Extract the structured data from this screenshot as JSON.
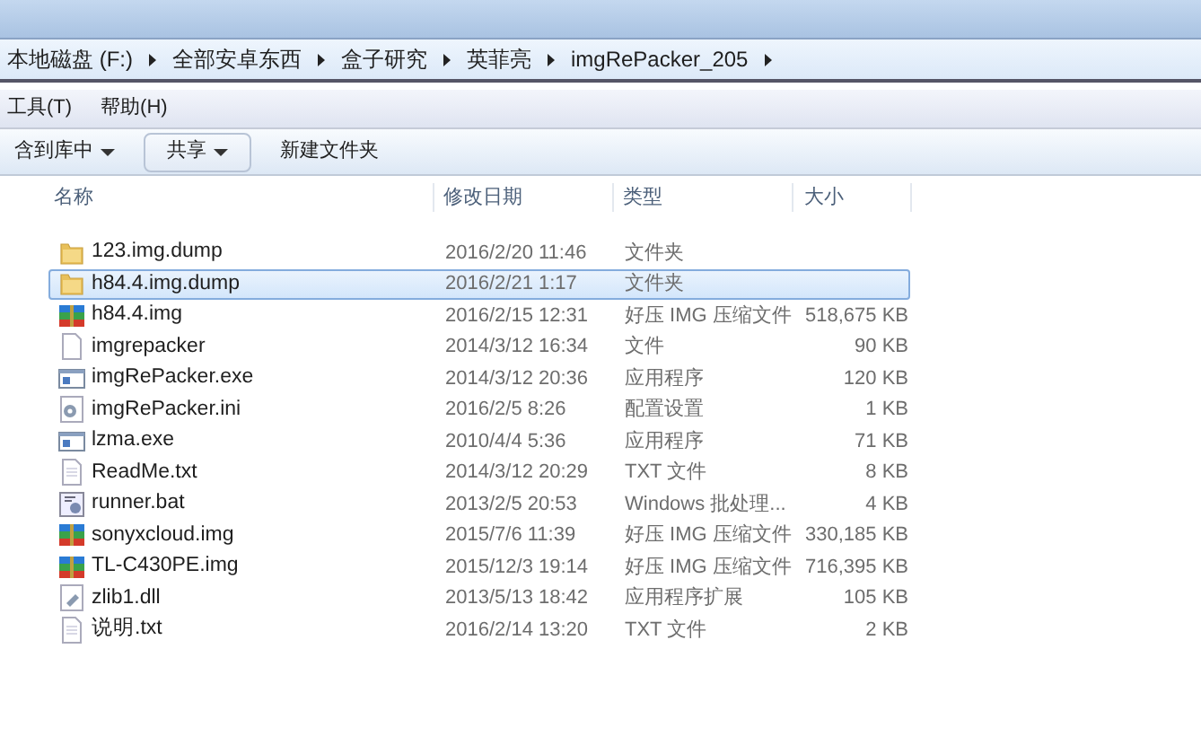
{
  "address_bar": {
    "crumbs": [
      "本地磁盘 (F:)",
      "全部安卓东西",
      "盒子研究",
      "英菲亮",
      "imgRePacker_205"
    ]
  },
  "menu_bar": {
    "items": [
      "工具(T)",
      "帮助(H)"
    ]
  },
  "toolbar": {
    "items": [
      {
        "label": "含到库中",
        "dropdown": true,
        "kind": "menu"
      },
      {
        "label": "共享",
        "dropdown": true,
        "kind": "button"
      },
      {
        "label": "新建文件夹",
        "dropdown": false,
        "kind": "menu"
      }
    ]
  },
  "table": {
    "columns": [
      "名称",
      "修改日期",
      "类型",
      "大小"
    ],
    "rows": [
      {
        "kind": "folder",
        "name": "123.img.dump",
        "date": "2016/2/20 11:46",
        "type": "文件夹",
        "selected": false
      },
      {
        "kind": "folder",
        "name": "h84.4.img.dump",
        "date": "2016/2/21 1:17",
        "type": "文件夹",
        "selected": true
      },
      {
        "kind": "archive",
        "name": "h84.4.img",
        "date": "2016/2/15 12:31",
        "type": "好压 IMG 压缩文件",
        "size": "518,675 KB",
        "selected": false
      },
      {
        "kind": "file",
        "name": "imgrepacker",
        "date": "2014/3/12 16:34",
        "type": "文件",
        "size": "90 KB",
        "selected": false
      },
      {
        "kind": "exe",
        "name": "imgRePacker.exe",
        "date": "2014/3/12 20:36",
        "type": "应用程序",
        "size": "120 KB",
        "selected": false
      },
      {
        "kind": "ini",
        "name": "imgRePacker.ini",
        "date": "2016/2/5 8:26",
        "type": "配置设置",
        "size": "1 KB",
        "selected": false
      },
      {
        "kind": "exe",
        "name": "lzma.exe",
        "date": "2010/4/4 5:36",
        "type": "应用程序",
        "size": "71 KB",
        "selected": false
      },
      {
        "kind": "text",
        "name": "ReadMe.txt",
        "date": "2014/3/12 20:29",
        "type": "TXT 文件",
        "size": "8 KB",
        "selected": false
      },
      {
        "kind": "bat",
        "name": "runner.bat",
        "date": "2013/2/5 20:53",
        "type": "Windows 批处理...",
        "size": "4 KB",
        "selected": false
      },
      {
        "kind": "archive",
        "name": "sonyxcloud.img",
        "date": "2015/7/6 11:39",
        "type": "好压 IMG 压缩文件",
        "size": "330,185 KB",
        "selected": false
      },
      {
        "kind": "archive",
        "name": "TL-C430PE.img",
        "date": "2015/12/3 19:14",
        "type": "好压 IMG 压缩文件",
        "size": "716,395 KB",
        "selected": false
      },
      {
        "kind": "dll",
        "name": "zlib1.dll",
        "date": "2013/5/13 18:42",
        "type": "应用程序扩展",
        "size": "105 KB",
        "selected": false
      },
      {
        "kind": "text",
        "name": "说明.txt",
        "date": "2016/2/14 13:20",
        "type": "TXT 文件",
        "size": "2 KB",
        "selected": false
      }
    ]
  }
}
